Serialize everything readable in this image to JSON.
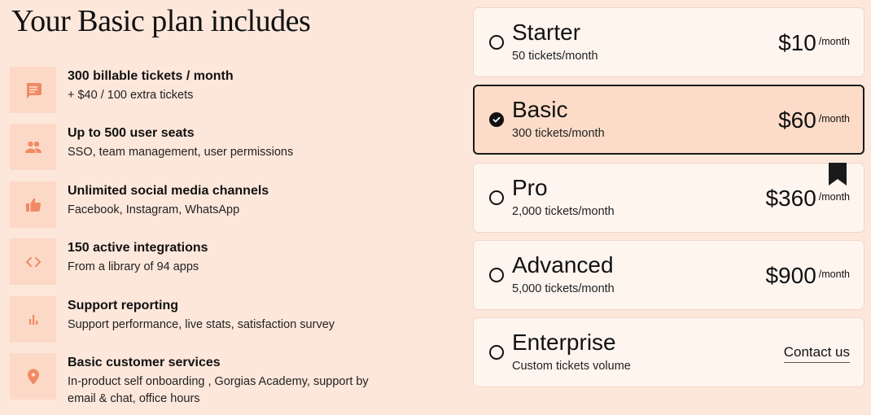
{
  "heading": "Your Basic plan includes",
  "features": [
    {
      "icon": "chat-icon",
      "title": "300 billable tickets / month",
      "desc": "+ $40 / 100 extra tickets"
    },
    {
      "icon": "users-icon",
      "title": "Up to 500 user seats",
      "desc": "SSO, team management, user permissions"
    },
    {
      "icon": "thumbs-up-icon",
      "title": "Unlimited social media channels",
      "desc": "Facebook, Instagram, WhatsApp"
    },
    {
      "icon": "code-icon",
      "title": "150 active integrations",
      "desc": "From a library of 94 apps"
    },
    {
      "icon": "bar-chart-icon",
      "title": "Support reporting",
      "desc": "Support performance, live stats, satisfaction survey"
    },
    {
      "icon": "location-pin-icon",
      "title": "Basic customer services",
      "desc": "In-product self onboarding , Gorgias Academy, support by email & chat, office hours"
    }
  ],
  "plans": [
    {
      "name": "Starter",
      "tickets": "50 tickets/month",
      "price": "$10",
      "per": "/month",
      "selected": false
    },
    {
      "name": "Basic",
      "tickets": "300 tickets/month",
      "price": "$60",
      "per": "/month",
      "selected": true
    },
    {
      "name": "Pro",
      "tickets": "2,000 tickets/month",
      "price": "$360",
      "per": "/month",
      "selected": false,
      "bookmark_icon": "bookmark-icon"
    },
    {
      "name": "Advanced",
      "tickets": "5,000 tickets/month",
      "price": "$900",
      "per": "/month",
      "selected": false
    },
    {
      "name": "Enterprise",
      "tickets": "Custom tickets volume",
      "contact": "Contact us",
      "selected": false
    }
  ],
  "colors": {
    "background": "#fde7db",
    "icon_tile": "#fcd9c6",
    "icon_accent": "#f08a64",
    "card": "#fef5ef",
    "selected_card": "#fcdcc8"
  }
}
